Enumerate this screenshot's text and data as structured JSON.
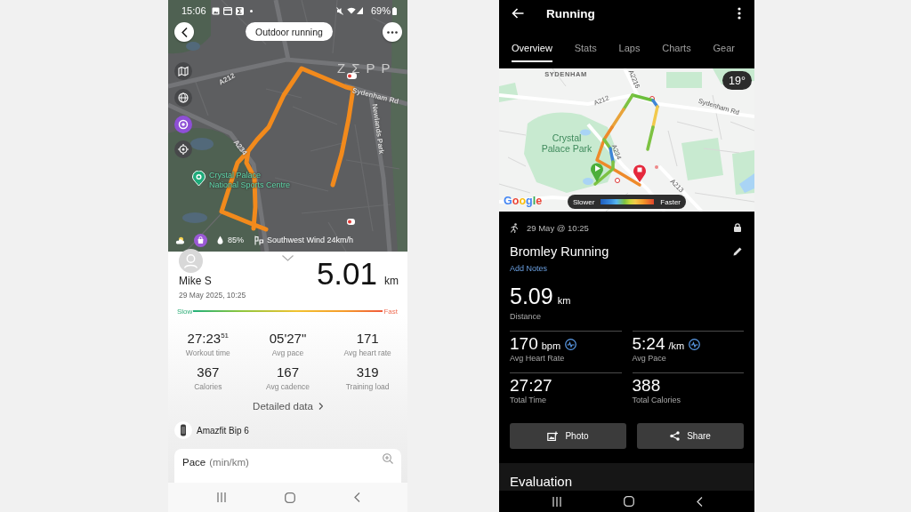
{
  "left_screen": {
    "status_bar": {
      "time": "15:06",
      "battery": "69%"
    },
    "top_bar": {
      "title": "Outdoor running"
    },
    "map": {
      "logo": "ZΣPP",
      "labels": [
        {
          "text": "A212",
          "kind": "road"
        },
        {
          "text": "Sydenham Rd",
          "kind": "road"
        },
        {
          "text": "Newlands Park",
          "kind": "road"
        },
        {
          "text": "A234",
          "kind": "road"
        },
        {
          "text": "Crystal Palace National Sports Centre",
          "kind": "place"
        }
      ],
      "weather": {
        "humidity": "85%",
        "wind": "Southwest Wind 24km/h"
      }
    },
    "summary": {
      "user": "Mike S",
      "date": "29 May 2025, 10:25",
      "distance": "5.01",
      "unit": "km"
    },
    "pace_scale": {
      "low": "Slow",
      "high": "Fast"
    },
    "stats": [
      {
        "value": "27:23$^{51}$",
        "label": "Workout time"
      },
      {
        "value": "05'27\"",
        "label": "Avg pace"
      },
      {
        "value": "171",
        "label": "Avg heart rate"
      },
      {
        "value": "367",
        "label": "Calories"
      },
      {
        "value": "167",
        "label": "Avg cadence"
      },
      {
        "value": "319",
        "label": "Training load"
      }
    ],
    "details_link": "Detailed data",
    "device": {
      "name": "Amazfit Bip 6"
    },
    "chart_card": {
      "title": "Pace",
      "unit": "(min/km)"
    }
  },
  "right_screen": {
    "header": {
      "title": "Running"
    },
    "tabs": [
      {
        "label": "Overview",
        "selected": true
      },
      {
        "label": "Stats",
        "selected": false
      },
      {
        "label": "Laps",
        "selected": false
      },
      {
        "label": "Charts",
        "selected": false
      },
      {
        "label": "Gear",
        "selected": false
      }
    ],
    "map": {
      "labels": [
        {
          "text": "SYDENHAM",
          "kind": "area"
        },
        {
          "text": "A2216",
          "kind": "road"
        },
        {
          "text": "A212",
          "kind": "road"
        },
        {
          "text": "Sydenham Rd",
          "kind": "road"
        },
        {
          "text": "Crystal Palace Park",
          "kind": "park"
        },
        {
          "text": "A234",
          "kind": "road"
        },
        {
          "text": "A213",
          "kind": "road"
        }
      ],
      "temperature": "19°",
      "attribution": "Google",
      "legend": {
        "low": "Slower",
        "high": "Faster"
      }
    },
    "activity": {
      "date": "29 May @ 10:25",
      "title": "Bromley Running",
      "notes_link": "Add Notes"
    },
    "distance": {
      "value": "5.09",
      "unit": "km",
      "label": "Distance"
    },
    "metrics": [
      {
        "value": "170",
        "unit": "bpm",
        "label": "Avg Heart Rate",
        "chart_link": true
      },
      {
        "value": "5:24",
        "unit": "/km",
        "label": "Avg Pace",
        "chart_link": true
      },
      {
        "value": "27:27",
        "label": "Total Time",
        "chart_link": false
      },
      {
        "value": "388",
        "label": "Total Calories",
        "chart_link": false
      }
    ],
    "buttons": [
      {
        "label": "Photo",
        "kind": "photo"
      },
      {
        "label": "Share",
        "kind": "share"
      }
    ],
    "section": {
      "title": "Evaluation"
    }
  }
}
